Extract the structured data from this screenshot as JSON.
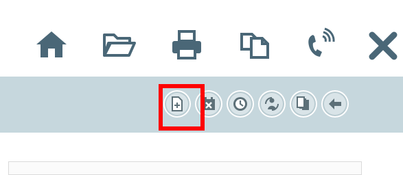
{
  "toolbar": {
    "icons": [
      "home-icon",
      "folder-open-icon",
      "print-icon",
      "copy-icon",
      "phone-icon",
      "close-icon"
    ],
    "color": "#4a6777"
  },
  "actions": {
    "icons": [
      "new-document-icon",
      "calendar-delete-icon",
      "clock-icon",
      "user-refresh-icon",
      "documents-icon",
      "back-arrow-icon"
    ],
    "selected": "new-document-icon",
    "icon_color": "#5d7078"
  },
  "theme": {
    "subbar_bg": "#c6d7dd",
    "highlight": "#ff0000"
  }
}
